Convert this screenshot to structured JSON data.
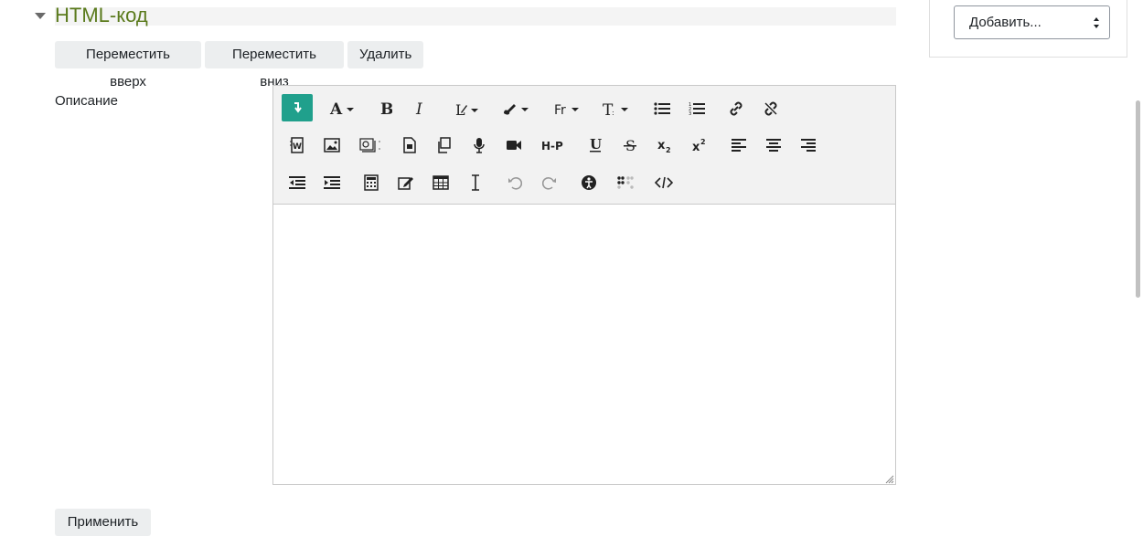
{
  "section": {
    "title": "HTML-код"
  },
  "actions": {
    "move_up": "Переместить вверх",
    "move_down": "Переместить вниз",
    "delete": "Удалить"
  },
  "description": {
    "label": "Описание",
    "editor_content": ""
  },
  "toolbar": {
    "font_family_label": "Ff",
    "hp_label": "H-P",
    "row1": [
      "collapse",
      "font-color",
      "bold",
      "italic",
      "style",
      "font-highlight",
      "font-family",
      "font-size",
      "unordered-list",
      "ordered-list",
      "link",
      "unlink"
    ],
    "row2": [
      "word-import",
      "image",
      "image-gallery",
      "document",
      "copy",
      "audio",
      "video",
      "h5p",
      "underline",
      "strikethrough",
      "subscript",
      "superscript",
      "align-left",
      "align-center",
      "align-right"
    ],
    "row3": [
      "outdent",
      "indent",
      "calculator",
      "edit",
      "table",
      "text-cursor",
      "undo",
      "redo",
      "accessibility",
      "screen-reader",
      "html-source"
    ]
  },
  "apply_button": "Применить",
  "sidebar": {
    "add_select_value": "Добавить..."
  },
  "colors": {
    "section_title": "#5a7a1c",
    "active_tool": "#20a08c",
    "button_bg": "#eceeef"
  }
}
